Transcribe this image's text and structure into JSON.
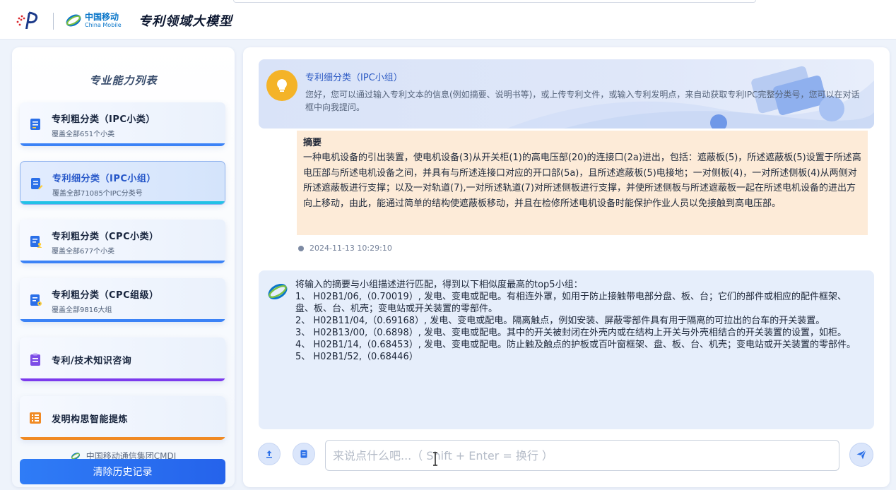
{
  "header": {
    "logo_icon": "patent-office-logo",
    "org_logo": {
      "zh": "中国移动",
      "en": "China Mobile"
    },
    "title": "专利领域大模型"
  },
  "sidebar": {
    "title": "专业能力列表",
    "items": [
      {
        "name": "专利粗分类（IPC小类）",
        "sub": "覆盖全部651个小类",
        "icon": "document-icon",
        "bar_color": "#3b82f6",
        "active": false
      },
      {
        "name": "专利细分类（IPC小组）",
        "sub": "覆盖全部71085个IPC分类号",
        "icon": "edit-document-icon",
        "bar_color": "#22c1e6",
        "active": true
      },
      {
        "name": "专利粗分类（CPC小类）",
        "sub": "覆盖全部677个小类",
        "icon": "document-user-icon",
        "bar_color": "#3b82f6",
        "active": false
      },
      {
        "name": "专利粗分类（CPC组级）",
        "sub": "覆盖全部9816大组",
        "icon": "document-gear-icon",
        "bar_color": "#3b82f6",
        "active": false
      },
      {
        "name": "专利/技术知识咨询",
        "sub": "",
        "icon": "clipboard-icon",
        "bar_color": "#7c3aed",
        "active": false
      },
      {
        "name": "发明构思智能提炼",
        "sub": "",
        "icon": "list-icon",
        "bar_color": "#f08a24",
        "active": false
      }
    ],
    "footer_org": "中国移动通信集团CMDI",
    "clear_button": "清除历史记录"
  },
  "banner": {
    "title": "专利细分类（IPC小组）",
    "desc": "您好，您可以通过输入专利文本的信息(例如摘要、说明书等)，或上传专利文件，或输入专利发明点，来自动获取专利IPC完整分类号，您可以在对话框中向我提问。"
  },
  "user_message": {
    "heading": "摘要",
    "body": "一种电机设备的引出装置，使电机设备(3)从开关柜(1)的高电压部(20)的连接口(2a)进出，包括：遮蔽板(5)，所述遮蔽板(5)设置于所述高电压部与所述电机设备之间，并具有与所述连接口对应的开口部(5a)，且所述遮蔽板(5)电接地；一对侧板(4)，一对所述侧板(4)从两侧对所述遮蔽板进行支撑；以及一对轨道(7),一对所述轨道(7)对所述侧板进行支撑，并使所述侧板与所述遮蔽板一起在所述电机设备的进出方向上移动，由此，能通过简单的结构使遮蔽板移动，并且在检修所述电机设备时能保护作业人员以免接触到高电压部。",
    "timestamp": "2024-11-13 10:29:10"
  },
  "bot_message": {
    "lines": [
      "将输入的摘要与小组描述进行匹配，得到以下相似度最高的top5小组：",
      "1、 H02B1/06,（0.70019）, 发电、变电或配电。有相连外罩，如用于防止接触带电部分盘、板、台；它们的部件或相应的配件框架、盘、板、台、机壳；变电站或开关装置的零部件。",
      "2、 H02B11/04,（0.69168）, 发电、变电或配电。隔离触点，例如安装、屏蔽零部件具有用于隔离的可拉出的台车的开关装置。",
      "3、 H02B13/00,（0.6898）, 发电、变电或配电。其中的开关被封闭在外壳内或在结构上开关与外壳相结合的开关装置的设置，如柜。",
      "4、 H02B1/14,（0.68453）, 发电、变电或配电。防止触及触点的护板或百叶窗框架、盘、板、台、机壳；变电站或开关装置的零部件。",
      "5、 H02B1/52,（0.68446）"
    ]
  },
  "input": {
    "placeholder": "来说点什么吧...（ Shift + Enter = 换行 ）",
    "value": "",
    "upload_icon": "upload-icon",
    "file_icon": "file-icon",
    "send_icon": "send-icon"
  }
}
